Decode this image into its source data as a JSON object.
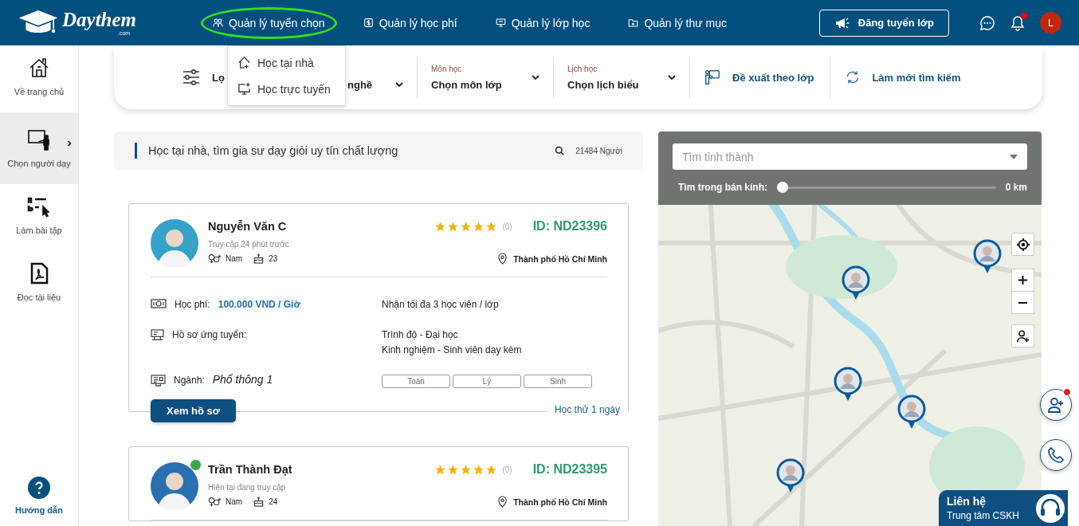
{
  "header": {
    "logo": {
      "name": "Daythem",
      "suffix": ".com"
    },
    "nav": [
      {
        "label": "Quản lý tuyển chọn",
        "highlighted": true
      },
      {
        "label": "Quản lý học phí",
        "highlighted": false
      },
      {
        "label": "Quản lý lớp học",
        "highlighted": false
      },
      {
        "label": "Quản lý thư mục",
        "highlighted": false
      }
    ],
    "post_button": "Đăng tuyển lớp",
    "has_notification": true,
    "avatar_letter": "L"
  },
  "dropdown_menu": [
    {
      "label": "Học tại nhà"
    },
    {
      "label": "Học trực tuyến"
    }
  ],
  "sidebar": {
    "items": [
      {
        "label": "Về trang chủ",
        "selected": false
      },
      {
        "label": "Chọn người dạy",
        "selected": true
      },
      {
        "label": "Làm bài tập",
        "selected": false
      },
      {
        "label": "Đọc tài liệu",
        "selected": false
      }
    ],
    "help": "Hướng dẫn"
  },
  "filter_bar": {
    "filter_label": "Lọ",
    "selects": [
      {
        "value": "nghề"
      },
      {
        "label": "Môn học",
        "value": "Chọn môn lớp"
      },
      {
        "label": "Lịch học",
        "value": "Chọn lịch biểu"
      }
    ],
    "actions": [
      {
        "label": "Đề xuất theo lớp"
      },
      {
        "label": "Làm mới tìm kiếm"
      }
    ]
  },
  "banner": {
    "text": "Học tại nhà, tìm gia sư dạy giỏi uy tín chất lượng",
    "count": "21484 Người"
  },
  "tutors": [
    {
      "name": "Nguyễn Văn C",
      "last_seen": "Truy cập 24 phút trước",
      "online": false,
      "gender": "Nam",
      "age": "23",
      "stars": 5,
      "reviews": "(0)",
      "id": "ID: ND23396",
      "location": "Thành phố Hồ Chí Minh",
      "fee_label": "Học phí:",
      "fee": "100.000 VND / Giờ",
      "capacity": "Nhận tối đa 3 học viên / lớp",
      "profile_label": "Hồ sơ ứng tuyển:",
      "profile_lines": [
        "Trình độ - Đại học",
        "Kinh nghiệm - Sinh viên dạy kèm"
      ],
      "major_label": "Ngành:",
      "major": "Phổ thông 1",
      "subjects": [
        "Toán",
        "Lý",
        "Sinh"
      ],
      "view_button": "Xem hồ sơ",
      "trial": "Học thử 1 ngày"
    },
    {
      "name": "Trần Thành Đạt",
      "last_seen": "Hiện tại đang truy cập",
      "online": true,
      "gender": "Nam",
      "age": "24",
      "stars": 5,
      "reviews": "(0)",
      "id": "ID: ND23395",
      "location": "Thành phố Hồ Chí Minh"
    }
  ],
  "map": {
    "search_placeholder": "Tìm tỉnh thành",
    "radius_label": "Tìm trong bán kính:",
    "level": 0,
    "radius_reading": "0 km"
  },
  "floating": {
    "has_badge": true,
    "contact_title": "Liên hệ",
    "contact_subtitle": "Trung tâm CSKH"
  }
}
